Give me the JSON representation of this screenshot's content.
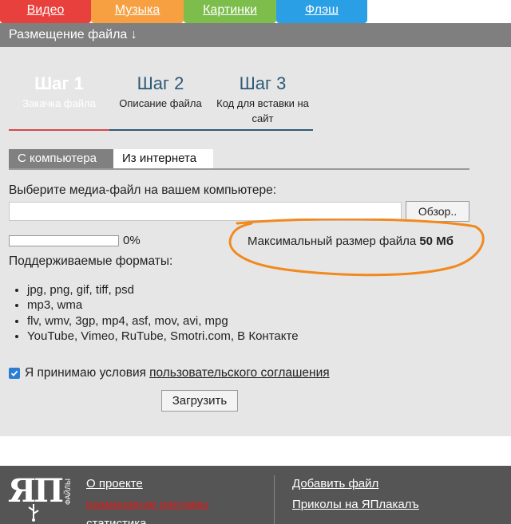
{
  "top_tabs": [
    {
      "label": "Видео",
      "color": "#e8403c"
    },
    {
      "label": "Музыка",
      "color": "#f6a042"
    },
    {
      "label": "Картинки",
      "color": "#7cbd4c"
    },
    {
      "label": "Флэш",
      "color": "#2a9fe6"
    }
  ],
  "header": {
    "title": "Размещение файла ↓"
  },
  "steps": [
    {
      "title": "Шаг 1",
      "subtitle": "Закачка файла"
    },
    {
      "title": "Шаг 2",
      "subtitle": "Описание файла"
    },
    {
      "title": "Шаг 3",
      "subtitle": "Код для вставки на сайт"
    }
  ],
  "source_tabs": [
    {
      "label": "С компьютера",
      "active": true
    },
    {
      "label": "Из интернета",
      "active": false
    }
  ],
  "upload": {
    "prompt": "Выберите медиа-файл на вашем компьютере:",
    "file_value": "",
    "browse_label": "Обзор..",
    "progress_percent": 0,
    "progress_text": "0%",
    "max_size_label": "Максимальный размер файла",
    "max_size_value": "50 Мб",
    "formats_label": "Поддерживаемые форматы:",
    "formats": [
      "jpg, png, gif, tiff, psd",
      "mp3, wma",
      "flv, wmv, 3gp, mp4, asf, mov, avi, mpg",
      "YouTube, Vimeo, RuTube, Smotri.com, В Контакте"
    ],
    "agree_checked": true,
    "agree_text": "Я принимаю условия",
    "agree_link": "пользовательского соглашения",
    "submit_label": "Загрузить"
  },
  "footer": {
    "logo_text": "ЯП",
    "logo_side": "ФАЙЛЫ",
    "links_left": [
      "О проекте",
      "размещение рекламы",
      "статистика"
    ],
    "links_right": [
      "Добавить файл",
      "Приколы на ЯПлакалъ"
    ]
  },
  "colors": {
    "highlight": "#f2891f",
    "footer_bg": "#555555",
    "main_bg": "#e6e6e6"
  }
}
